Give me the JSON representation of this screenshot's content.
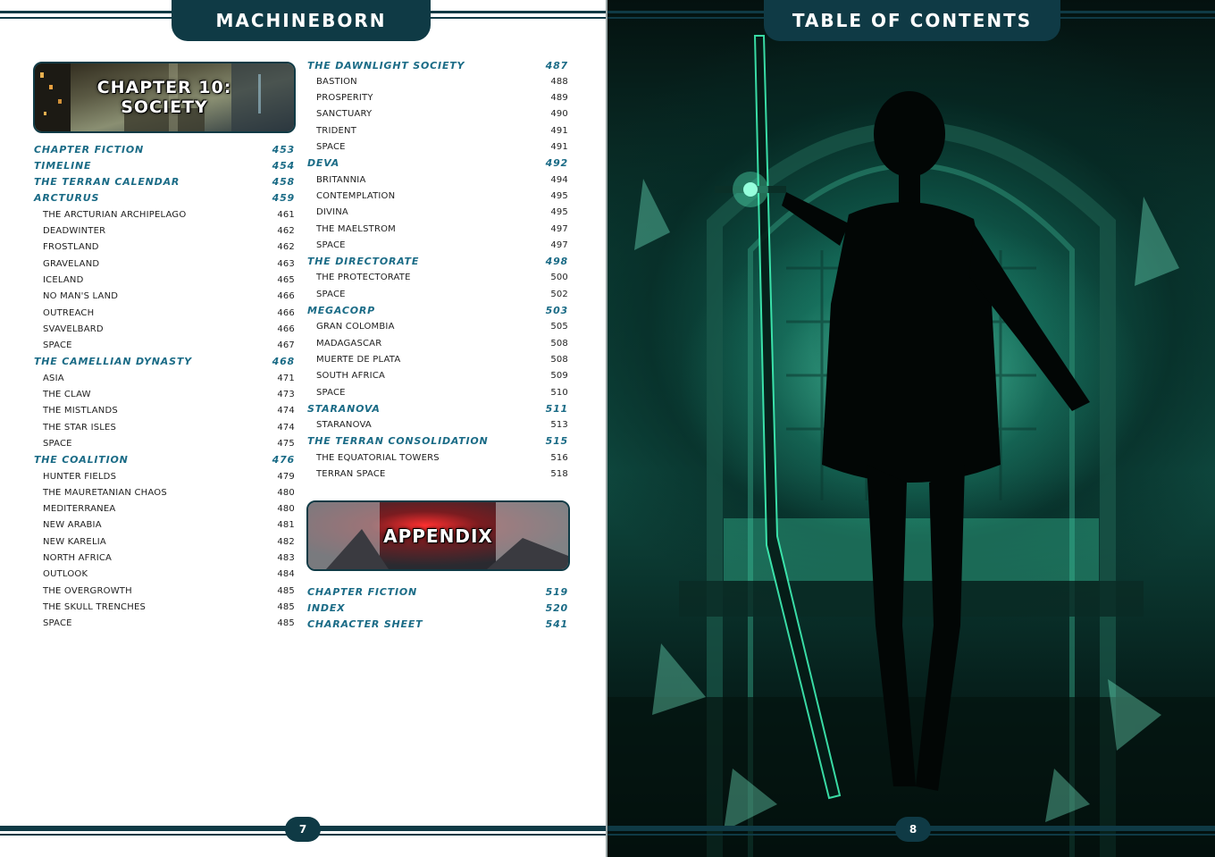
{
  "left_page": {
    "header_title": "MACHINEBORN",
    "page_number": "7",
    "chapter_banner": {
      "line1": "CHAPTER 10:",
      "line2": "SOCIETY"
    },
    "appendix_banner": "APPENDIX",
    "column1": [
      {
        "label": "CHAPTER FICTION",
        "page": "453",
        "type": "major"
      },
      {
        "label": "TIMELINE",
        "page": "454",
        "type": "major"
      },
      {
        "label": "THE TERRAN CALENDAR",
        "page": "458",
        "type": "major"
      },
      {
        "label": "ARCTURUS",
        "page": "459",
        "type": "major"
      },
      {
        "label": "THE ARCTURIAN ARCHIPELAGO",
        "page": "461",
        "type": "minor"
      },
      {
        "label": "DEADWINTER",
        "page": "462",
        "type": "minor"
      },
      {
        "label": "FROSTLAND",
        "page": "462",
        "type": "minor"
      },
      {
        "label": "GRAVELAND",
        "page": "463",
        "type": "minor"
      },
      {
        "label": "ICELAND",
        "page": "465",
        "type": "minor"
      },
      {
        "label": "NO MAN'S LAND",
        "page": "466",
        "type": "minor"
      },
      {
        "label": "OUTREACH",
        "page": "466",
        "type": "minor"
      },
      {
        "label": "SVAVELBARD",
        "page": "466",
        "type": "minor"
      },
      {
        "label": "SPACE",
        "page": "467",
        "type": "minor"
      },
      {
        "label": "THE CAMELLIAN DYNASTY",
        "page": "468",
        "type": "major"
      },
      {
        "label": "ASIA",
        "page": "471",
        "type": "minor"
      },
      {
        "label": "THE CLAW",
        "page": "473",
        "type": "minor"
      },
      {
        "label": "THE MISTLANDS",
        "page": "474",
        "type": "minor"
      },
      {
        "label": "THE STAR ISLES",
        "page": "474",
        "type": "minor"
      },
      {
        "label": "SPACE",
        "page": "475",
        "type": "minor"
      },
      {
        "label": "THE COALITION",
        "page": "476",
        "type": "major"
      },
      {
        "label": "HUNTER FIELDS",
        "page": "479",
        "type": "minor"
      },
      {
        "label": "THE MAURETANIAN CHAOS",
        "page": "480",
        "type": "minor"
      },
      {
        "label": "MEDITERRANEA",
        "page": "480",
        "type": "minor"
      },
      {
        "label": "NEW ARABIA",
        "page": "481",
        "type": "minor"
      },
      {
        "label": "NEW KARELIA",
        "page": "482",
        "type": "minor"
      },
      {
        "label": "NORTH AFRICA",
        "page": "483",
        "type": "minor"
      },
      {
        "label": "OUTLOOK",
        "page": "484",
        "type": "minor"
      },
      {
        "label": "THE OVERGROWTH",
        "page": "485",
        "type": "minor"
      },
      {
        "label": "THE SKULL TRENCHES",
        "page": "485",
        "type": "minor"
      },
      {
        "label": "SPACE",
        "page": "485",
        "type": "minor"
      }
    ],
    "column2": [
      {
        "label": "THE DAWNLIGHT SOCIETY",
        "page": "487",
        "type": "major"
      },
      {
        "label": "BASTION",
        "page": "488",
        "type": "minor"
      },
      {
        "label": "PROSPERITY",
        "page": "489",
        "type": "minor"
      },
      {
        "label": "SANCTUARY",
        "page": "490",
        "type": "minor"
      },
      {
        "label": "TRIDENT",
        "page": "491",
        "type": "minor"
      },
      {
        "label": "SPACE",
        "page": "491",
        "type": "minor"
      },
      {
        "label": "DEVA",
        "page": "492",
        "type": "major"
      },
      {
        "label": "BRITANNIA",
        "page": "494",
        "type": "minor"
      },
      {
        "label": "CONTEMPLATION",
        "page": "495",
        "type": "minor"
      },
      {
        "label": "DIVINA",
        "page": "495",
        "type": "minor"
      },
      {
        "label": "THE MAELSTROM",
        "page": "497",
        "type": "minor"
      },
      {
        "label": "SPACE",
        "page": "497",
        "type": "minor"
      },
      {
        "label": "THE DIRECTORATE",
        "page": "498",
        "type": "major"
      },
      {
        "label": "THE PROTECTORATE",
        "page": "500",
        "type": "minor"
      },
      {
        "label": "SPACE",
        "page": "502",
        "type": "minor"
      },
      {
        "label": "MEGACORP",
        "page": "503",
        "type": "major"
      },
      {
        "label": "GRAN COLOMBIA",
        "page": "505",
        "type": "minor"
      },
      {
        "label": "MADAGASCAR",
        "page": "508",
        "type": "minor"
      },
      {
        "label": "MUERTE DE PLATA",
        "page": "508",
        "type": "minor"
      },
      {
        "label": "SOUTH AFRICA",
        "page": "509",
        "type": "minor"
      },
      {
        "label": "SPACE",
        "page": "510",
        "type": "minor"
      },
      {
        "label": "STARANOVA",
        "page": "511",
        "type": "major"
      },
      {
        "label": "STARANOVA",
        "page": "513",
        "type": "minor"
      },
      {
        "label": "THE TERRAN CONSOLIDATION",
        "page": "515",
        "type": "major"
      },
      {
        "label": "THE EQUATORIAL TOWERS",
        "page": "516",
        "type": "minor"
      },
      {
        "label": "TERRAN SPACE",
        "page": "518",
        "type": "minor"
      }
    ],
    "appendix_entries": [
      {
        "label": "CHAPTER FICTION",
        "page": "519",
        "type": "major"
      },
      {
        "label": "INDEX",
        "page": "520",
        "type": "major"
      },
      {
        "label": "CHARACTER SHEET",
        "page": "541",
        "type": "major"
      }
    ]
  },
  "right_page": {
    "header_title": "TABLE OF CONTENTS",
    "page_number": "8",
    "illustration": "silhouette-swordswoman-green-hangar"
  },
  "colors": {
    "brand": "#0f3a45",
    "heading": "#1a6b86",
    "glow": "#5cffc8"
  }
}
